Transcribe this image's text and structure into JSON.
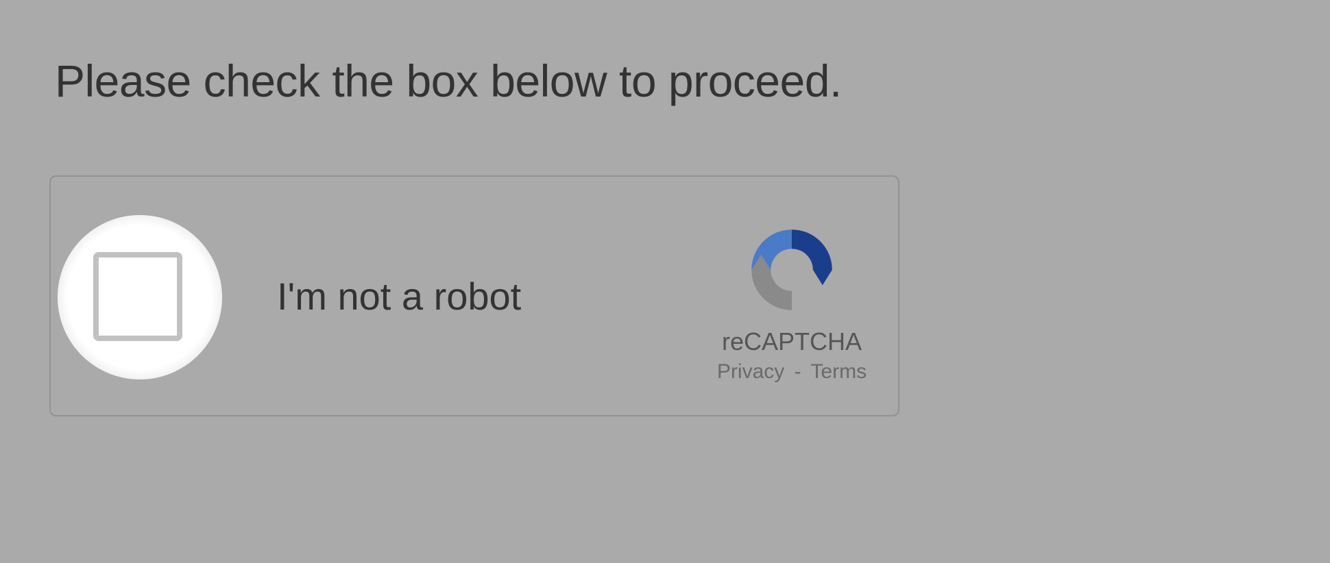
{
  "instruction": "Please check the box below to proceed.",
  "captcha": {
    "checkbox_label": "I'm not a robot",
    "brand": "reCAPTCHA",
    "privacy_label": "Privacy",
    "terms_label": "Terms",
    "separator": "-"
  }
}
